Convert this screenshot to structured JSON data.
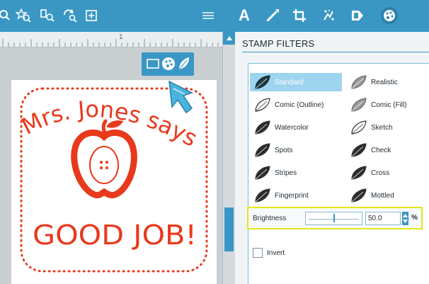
{
  "panel": {
    "title": "STAMP FILTERS"
  },
  "filters": [
    {
      "label": "Standard",
      "icon": "standard-leaf-icon",
      "selected": true
    },
    {
      "label": "Realistic",
      "icon": "realistic-leaf-icon",
      "selected": false
    },
    {
      "label": "Comic (Outline)",
      "icon": "comic-outline-leaf-icon",
      "selected": false
    },
    {
      "label": "Comic (Fill)",
      "icon": "comic-fill-leaf-icon",
      "selected": false
    },
    {
      "label": "Watercolor",
      "icon": "watercolor-leaf-icon",
      "selected": false
    },
    {
      "label": "Sketch",
      "icon": "sketch-leaf-icon",
      "selected": false
    },
    {
      "label": "Spots",
      "icon": "spots-leaf-icon",
      "selected": false
    },
    {
      "label": "Check",
      "icon": "check-leaf-icon",
      "selected": false
    },
    {
      "label": "Stripes",
      "icon": "stripes-leaf-icon",
      "selected": false
    },
    {
      "label": "Cross",
      "icon": "cross-leaf-icon",
      "selected": false
    },
    {
      "label": "Fingerprint",
      "icon": "fingerprint-leaf-icon",
      "selected": false
    },
    {
      "label": "Mottled",
      "icon": "mottled-leaf-icon",
      "selected": false
    }
  ],
  "brightness": {
    "label": "Brightness",
    "value": "50.0",
    "unit": "%",
    "level": 0.5
  },
  "invert": {
    "label": "Invert",
    "checked": false
  },
  "stamp": {
    "line1": "Mrs. Jones says",
    "line2": "GOOD JOB!",
    "ink_color": "#e8391c"
  },
  "ruler": {
    "labels": [
      "1"
    ]
  },
  "colors": {
    "accent": "#3a97c4",
    "highlight": "#e4e61c",
    "selected": "#9fd4ee"
  },
  "toolbar": {
    "left_icons": [
      "zoom-icon",
      "zoom-star-icon",
      "zoom-fit-icon",
      "zoom-rotate-icon",
      "add-frame-icon"
    ],
    "right_icons": [
      "menu-lines-icon",
      "text-tool-icon",
      "draw-tool-icon",
      "crop-tool-icon",
      "effects-tool-icon",
      "shape-tool-icon",
      "palette-tool-icon"
    ],
    "text_tool_label": "A"
  }
}
